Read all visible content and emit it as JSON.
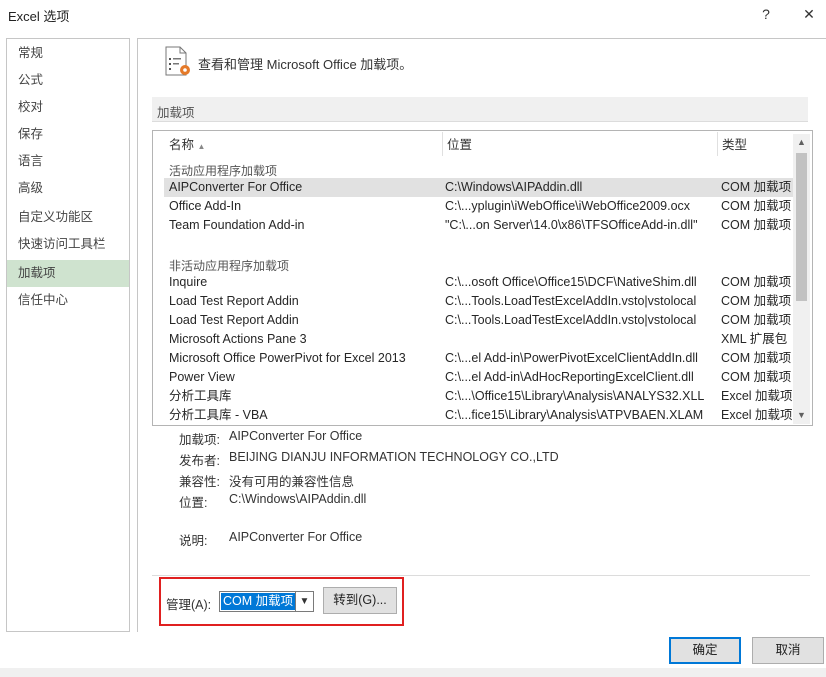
{
  "window": {
    "title": "Excel 选项",
    "help": "?",
    "close": "✕"
  },
  "nav": {
    "items": [
      "常规",
      "公式",
      "校对",
      "保存",
      "语言",
      "高级",
      "自定义功能区",
      "快速访问工具栏",
      "加载项",
      "信任中心"
    ],
    "selected": "加载项"
  },
  "header": {
    "text": "查看和管理 Microsoft Office 加载项。"
  },
  "section": {
    "label": "加载项"
  },
  "table": {
    "columns": [
      "名称",
      "位置",
      "类型"
    ],
    "groups": [
      {
        "title": "活动应用程序加载项",
        "rows": [
          {
            "name": "AIPConverter For Office",
            "location": "C:\\Windows\\AIPAddin.dll",
            "type": "COM 加载项"
          },
          {
            "name": "Office Add-In",
            "location": "C:\\...yplugin\\iWebOffice\\iWebOffice2009.ocx",
            "type": "COM 加载项"
          },
          {
            "name": "Team Foundation Add-in",
            "location": "\"C:\\...on Server\\14.0\\x86\\TFSOfficeAdd-in.dll\"",
            "type": "COM 加载项"
          }
        ]
      },
      {
        "title": "非活动应用程序加载项",
        "rows": [
          {
            "name": "Inquire",
            "location": "C:\\...osoft Office\\Office15\\DCF\\NativeShim.dll",
            "type": "COM 加载项"
          },
          {
            "name": "Load Test Report Addin",
            "location": "C:\\...Tools.LoadTestExcelAddIn.vsto|vstolocal",
            "type": "COM 加载项"
          },
          {
            "name": "Load Test Report Addin",
            "location": "C:\\...Tools.LoadTestExcelAddIn.vsto|vstolocal",
            "type": "COM 加载项"
          },
          {
            "name": "Microsoft Actions Pane 3",
            "location": "",
            "type": "XML 扩展包"
          },
          {
            "name": "Microsoft Office PowerPivot for Excel 2013",
            "location": "C:\\...el Add-in\\PowerPivotExcelClientAddIn.dll",
            "type": "COM 加载项"
          },
          {
            "name": "Power View",
            "location": "C:\\...el Add-in\\AdHocReportingExcelClient.dll",
            "type": "COM 加载项"
          },
          {
            "name": "分析工具库",
            "location": "C:\\...\\Office15\\Library\\Analysis\\ANALYS32.XLL",
            "type": "Excel 加载项"
          },
          {
            "name": "分析工具库 - VBA",
            "location": "C:\\...fice15\\Library\\Analysis\\ATPVBAEN.XLAM",
            "type": "Excel 加载项"
          }
        ]
      }
    ],
    "scroll_up": "▲",
    "scroll_down": "▼"
  },
  "details": {
    "addin_label": "加载项:",
    "addin_value": "AIPConverter For Office",
    "publisher_label": "发布者:",
    "publisher_value": "BEIJING DIANJU INFORMATION TECHNOLOGY CO.,LTD",
    "compat_label": "兼容性:",
    "compat_value": "没有可用的兼容性信息",
    "location_label": "位置:",
    "location_value": "C:\\Windows\\AIPAddin.dll",
    "desc_label": "说明:",
    "desc_value": "AIPConverter For Office"
  },
  "manage": {
    "label": "管理(A):",
    "selected": "COM 加载项",
    "go_button": "转到(G)..."
  },
  "footer": {
    "ok": "确定",
    "cancel": "取消"
  },
  "colors": {
    "nav_selected": "#cfe3cf",
    "select_highlight": "#0078d7",
    "annotation_box": "#e02020"
  }
}
